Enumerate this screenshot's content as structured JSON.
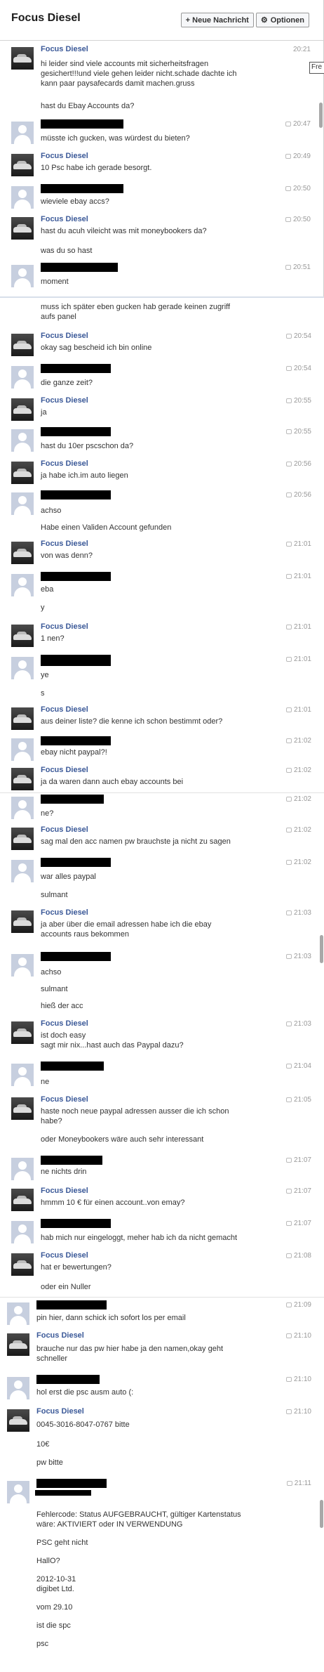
{
  "header": {
    "title": "Focus Diesel",
    "new_message": "+ Neue Nachricht",
    "options": "Optionen"
  },
  "tooltip": "Fre",
  "messages": {
    "m1": {
      "name": "Focus Diesel",
      "time": "20:21",
      "lines": [
        "hi leider sind viele accounts mit sicherheitsfragen",
        "gesichert!!!und viele gehen leider nicht.schade dachte ich",
        "kann paar paysafecards damit machen.gruss"
      ],
      "extra": "hast du Ebay Accounts da?"
    },
    "m2": {
      "time": "20:47",
      "line": "müsste ich gucken, was würdest du bieten?"
    },
    "m3": {
      "name": "Focus Diesel",
      "time": "20:49",
      "line": "10 Psc habe ich gerade besorgt."
    },
    "m4": {
      "time": "20:50",
      "line": "wieviele ebay accs?"
    },
    "m5": {
      "name": "Focus Diesel",
      "time": "20:50",
      "line": "hast du acuh vileicht was mit moneybookers da?",
      "extra": "was du so hast"
    },
    "m6": {
      "time": "20:51",
      "line": "moment"
    },
    "c1": [
      "muss ich später eben gucken hab gerade keinen zugriff",
      "aufs panel"
    ],
    "m7": {
      "name": "Focus Diesel",
      "time": "20:54",
      "line": "okay sag bescheid ich bin online"
    },
    "m8": {
      "time": "20:54",
      "line": "die ganze zeit?"
    },
    "m9": {
      "name": "Focus Diesel",
      "time": "20:55",
      "line": "ja"
    },
    "m10": {
      "time": "20:55",
      "line": "hast du 10er pscschon da?"
    },
    "m11": {
      "name": "Focus Diesel",
      "time": "20:56",
      "line": "ja habe ich.im auto liegen"
    },
    "m12": {
      "time": "20:56",
      "line": "achso",
      "extra": "Habe einen Validen Account gefunden"
    },
    "m13": {
      "name": "Focus Diesel",
      "time": "21:01",
      "line": "von was denn?"
    },
    "m14": {
      "time": "21:01",
      "line": "eba",
      "extra": "y"
    },
    "m15": {
      "name": "Focus Diesel",
      "time": "21:01",
      "line": "1 nen?"
    },
    "m16": {
      "time": "21:01",
      "line": "ye",
      "extra": "s"
    },
    "m17": {
      "name": "Focus Diesel",
      "time": "21:01",
      "line": "aus deiner liste? die kenne ich schon bestimmt oder?"
    },
    "m18": {
      "time": "21:02",
      "line": "ebay nicht paypal?!"
    },
    "m19": {
      "name": "Focus Diesel",
      "time": "21:02",
      "line": "ja da waren dann auch ebay accounts bei"
    },
    "m20": {
      "time": "21:02",
      "line": "ne?"
    },
    "m21": {
      "name": "Focus Diesel",
      "time": "21:02",
      "line": "sag mal den acc namen pw brauchste ja nicht zu sagen"
    },
    "m22": {
      "time": "21:02",
      "line": "war alles paypal",
      "extra": "sulmant"
    },
    "m23": {
      "name": "Focus Diesel",
      "time": "21:03",
      "lines": [
        "ja aber über die email adressen habe ich die ebay",
        "accounts raus bekommen"
      ]
    },
    "m24": {
      "time": "21:03",
      "line": "achso",
      "extras": [
        "sulmant",
        "hieß der acc"
      ]
    },
    "m25": {
      "name": "Focus Diesel",
      "time": "21:03",
      "lines": [
        "ist doch easy",
        "sagt mir nix...hast auch das Paypal dazu?"
      ]
    },
    "m26": {
      "time": "21:04",
      "line": "ne"
    },
    "m27": {
      "name": "Focus Diesel",
      "time": "21:05",
      "lines": [
        "haste noch neue paypal adressen ausser die ich schon",
        "habe?"
      ],
      "extra": "oder Moneybookers wäre auch sehr interessant"
    },
    "m28": {
      "time": "21:07",
      "line": "ne nichts drin"
    },
    "m29": {
      "name": "Focus Diesel",
      "time": "21:07",
      "line": "hmmm 10 € für einen account..von emay?"
    },
    "m30": {
      "time": "21:07",
      "line": "hab mich nur eingeloggt, meher hab ich da nicht gemacht"
    },
    "m31": {
      "name": "Focus Diesel",
      "time": "21:08",
      "line": "hat er bewertungen?",
      "extra": "oder ein Nuller"
    },
    "m32": {
      "time": "21:09",
      "line": "pin hier, dann schick ich sofort los per email"
    },
    "m33": {
      "name": "Focus Diesel",
      "time": "21:10",
      "lines": [
        "brauche nur das pw hier habe ja den namen,okay geht",
        "schneller"
      ]
    },
    "m34": {
      "time": "21:10",
      "line": "hol erst die psc ausm auto (:"
    },
    "m35": {
      "name": "Focus Diesel",
      "time": "21:10",
      "line": "0045-3016-8047-0767 bitte",
      "extras": [
        "10€",
        "pw bitte"
      ]
    },
    "m36": {
      "time": "21:11",
      "extras": [
        "Fehlercode: Status AUFGEBRAUCHT, gültiger Kartenstatus",
        "wäre: AKTIVIERT oder IN VERWENDUNG",
        "PSC geht nicht",
        "HallO?",
        "2012-10-31",
        "digibet Ltd.",
        "vom 29.10",
        "ist die spc",
        "psc"
      ]
    }
  }
}
